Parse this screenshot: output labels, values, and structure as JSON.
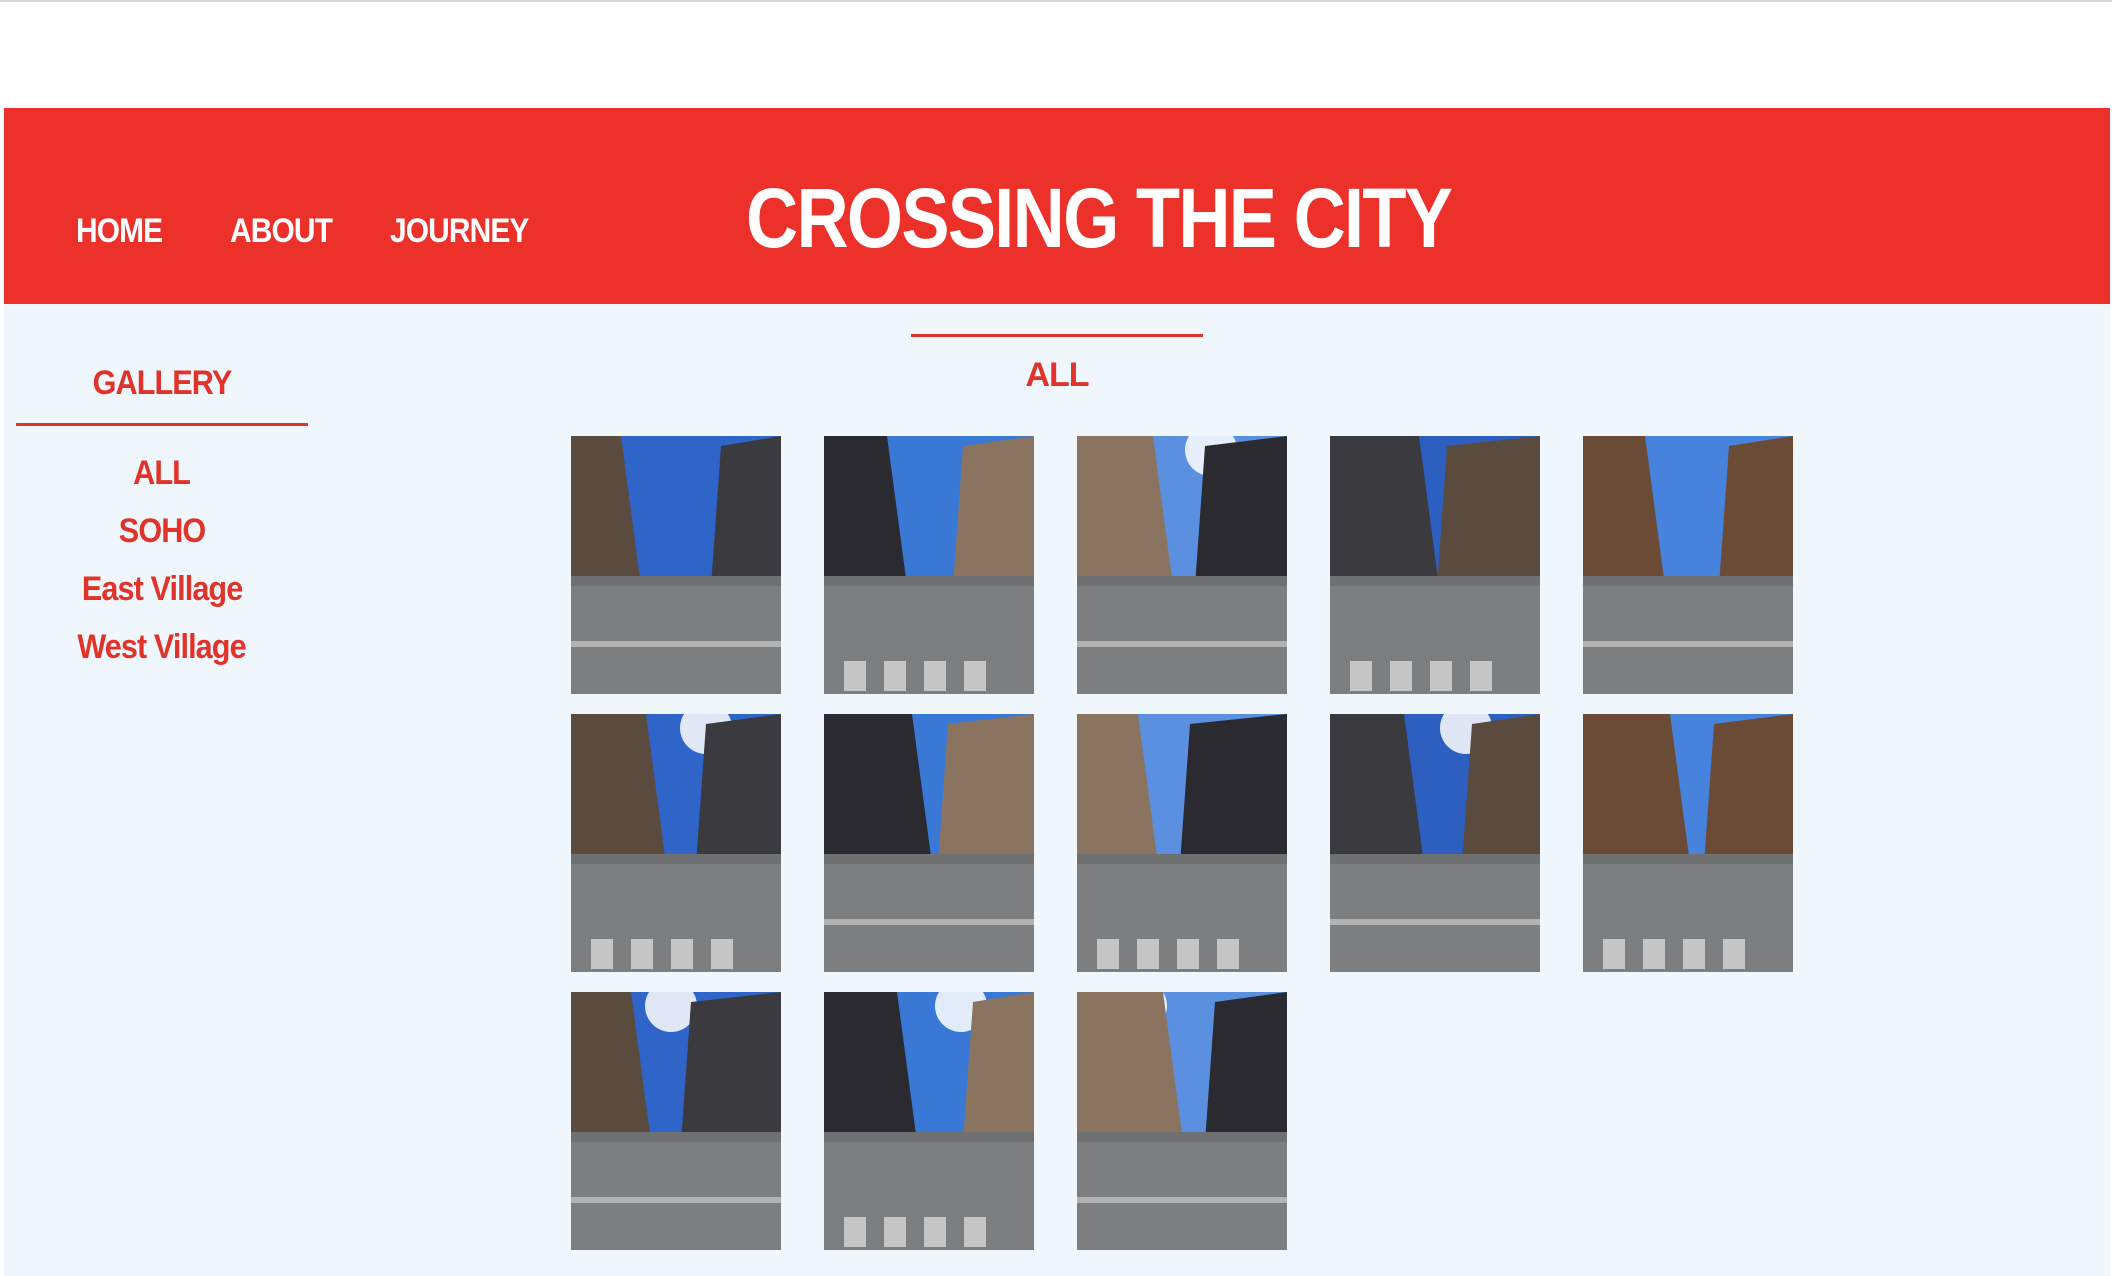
{
  "colors": {
    "brand_red": "#ec312b",
    "link_red": "#e2332b",
    "page_bg": "#eff6fc",
    "header_text": "#ffffff"
  },
  "nav": {
    "home": "HOME",
    "about": "ABOUT",
    "journey": "JOURNEY"
  },
  "site_title": "CROSSING THE CITY",
  "sidebar": {
    "heading": "GALLERY",
    "items": [
      {
        "label": "ALL"
      },
      {
        "label": "SOHO"
      },
      {
        "label": "East Village"
      },
      {
        "label": "West Village"
      }
    ]
  },
  "gallery": {
    "active_filter": "ALL",
    "photos": [
      {
        "name": "street-photo-1"
      },
      {
        "name": "street-photo-2"
      },
      {
        "name": "street-photo-3"
      },
      {
        "name": "street-photo-4"
      },
      {
        "name": "street-photo-5"
      },
      {
        "name": "street-photo-6"
      },
      {
        "name": "street-photo-7"
      },
      {
        "name": "street-photo-8"
      },
      {
        "name": "street-photo-9"
      },
      {
        "name": "street-photo-10"
      },
      {
        "name": "street-photo-11"
      },
      {
        "name": "street-photo-12"
      },
      {
        "name": "street-photo-13"
      }
    ]
  }
}
